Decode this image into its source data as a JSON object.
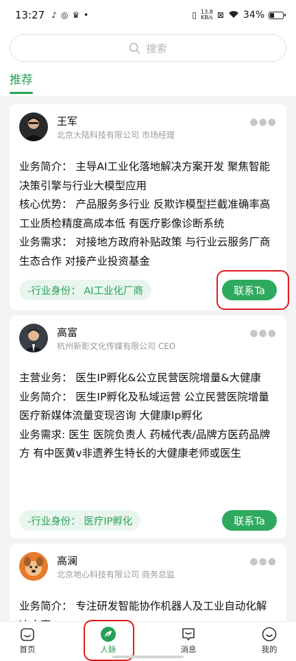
{
  "status_bar": {
    "time": "13:27",
    "net_speed_value": "13.8",
    "net_speed_unit": "KB/s",
    "battery_text": "34%",
    "battery_level": 0.34
  },
  "search": {
    "placeholder": "搜索"
  },
  "tabs": [
    {
      "label": "推荐",
      "active": true
    }
  ],
  "cards": [
    {
      "name": "王军",
      "company": "北京大陆科技有限公司 市场经理",
      "lines": [
        "业务简介：  主导AI工业化落地解决方案开发 聚焦智能决策引擎与行业大模型应用",
        "核心优势：  产品服务多行业 反欺诈模型拦截准确率高 工业质检精度高成本低 有医疗影像诊断系统",
        "业务需求：  对接地方政府补贴政策 与行业云服务厂商生态合作 对接产业投资基金"
      ],
      "tag": "-行业身份：  AI工业化厂商",
      "button": "联系Ta"
    },
    {
      "name": "高富",
      "company": "杭州新影文化传媒有限公司 CEO",
      "lines": [
        "主营业务：  医生IP孵化&公立民营医院增量&大健康",
        "业务简介：  医生IP孵化及私域运营 公立民营医院增量 医疗新媒体流量变现咨询 大健康Ip孵化",
        "业务需求: 医生 医院负责人 药械代表/品牌方医药品牌方 有中医黄v非遗养生特长的大健康老师或医生"
      ],
      "tag": "-行业身份：  医疗IP孵化",
      "button": "联系Ta"
    },
    {
      "name": "高澜",
      "company": "北京地心科技有限公司 商务总监",
      "lines": [
        "业务简介：  专注研发智能协作机器人及工业自动化解决方案"
      ]
    }
  ],
  "bottom_nav": [
    {
      "label": "首页",
      "icon": "home-icon"
    },
    {
      "label": "人脉",
      "icon": "leaf-icon",
      "active": true
    },
    {
      "label": "消息",
      "icon": "message-icon"
    },
    {
      "label": "我的",
      "icon": "profile-icon"
    }
  ],
  "colors": {
    "accent": "#27a157",
    "highlight": "#e01a1a"
  }
}
